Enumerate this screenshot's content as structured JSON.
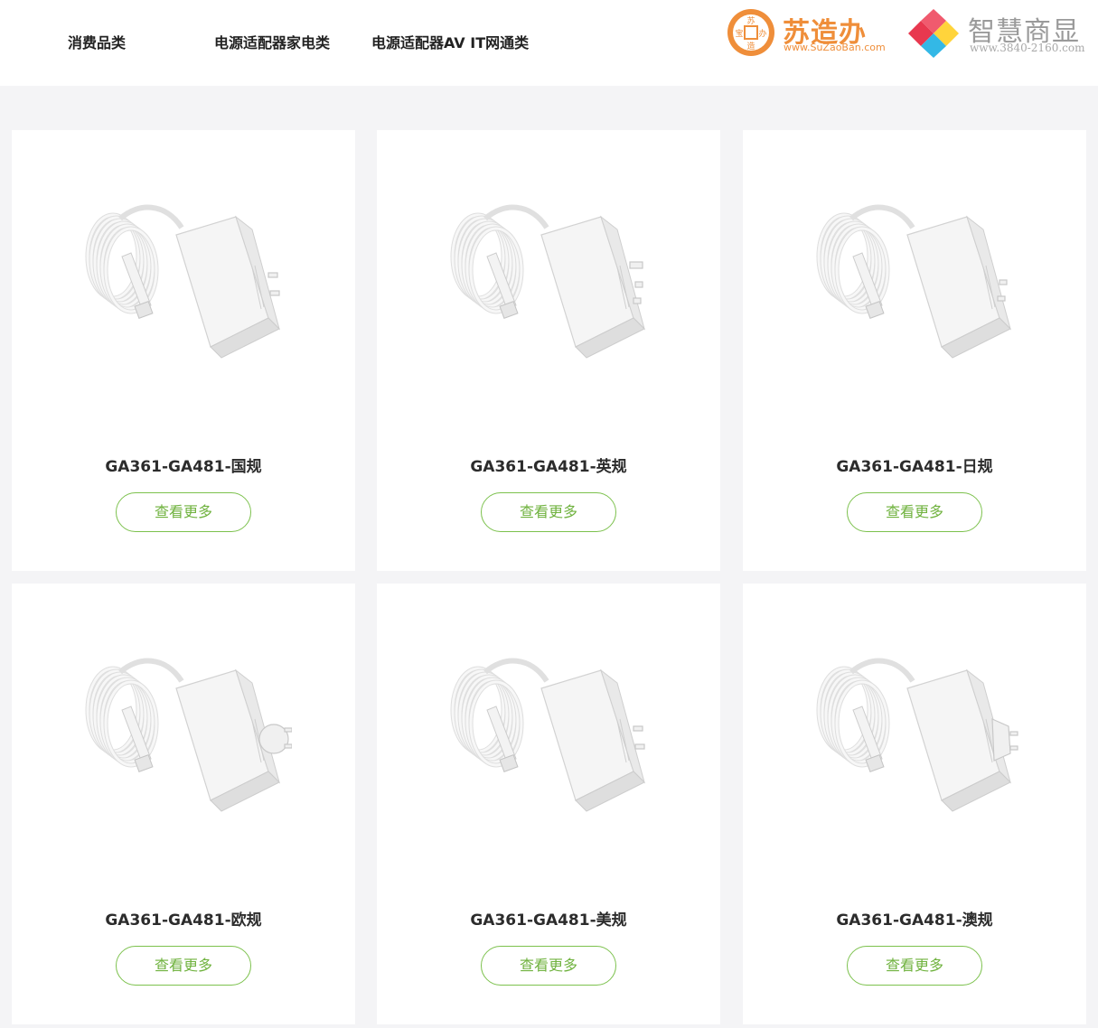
{
  "nav": {
    "items": [
      {
        "label": "消费品类"
      },
      {
        "label": "电源适配器家电类"
      },
      {
        "label": "电源适配器AV IT网通类"
      }
    ]
  },
  "logos": {
    "suzaoban": {
      "name": "苏造办",
      "url": "www.SuZaoBan.com",
      "seal_chars": [
        "苏",
        "宝",
        "办",
        "造"
      ],
      "color": "#ef8e3a"
    },
    "zhihui": {
      "name": "智慧商显",
      "url": "www.3840-2160.com",
      "colors": [
        "#e8384f",
        "#ffd43b",
        "#33b8e6"
      ]
    }
  },
  "products": [
    {
      "title": "GA361-GA481-国规",
      "button": "查看更多",
      "plug": "cn-icon"
    },
    {
      "title": "GA361-GA481-英规",
      "button": "查看更多",
      "plug": "uk-icon"
    },
    {
      "title": "GA361-GA481-日规",
      "button": "查看更多",
      "plug": "jp-icon"
    },
    {
      "title": "GA361-GA481-欧规",
      "button": "查看更多",
      "plug": "eu-icon"
    },
    {
      "title": "GA361-GA481-美规",
      "button": "查看更多",
      "plug": "us-icon"
    },
    {
      "title": "GA361-GA481-澳规",
      "button": "查看更多",
      "plug": "au-icon"
    }
  ],
  "colors": {
    "accent_green": "#7cc14d",
    "background": "#f4f4f6"
  }
}
